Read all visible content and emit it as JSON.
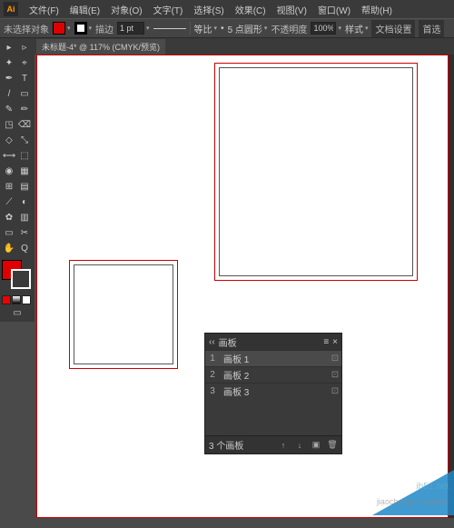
{
  "menu": {
    "items": [
      "文件(F)",
      "编辑(E)",
      "对象(O)",
      "文字(T)",
      "选择(S)",
      "效果(C)",
      "视图(V)",
      "窗口(W)",
      "帮助(H)"
    ]
  },
  "control": {
    "no_selection": "未选择对象",
    "fill_color": "#e00000",
    "stroke_color": "#000000",
    "stroke_label": "描边",
    "stroke_weight": "1 pt",
    "scale_label": "等比",
    "corner_label": "5 点圆形",
    "opacity_label": "不透明度",
    "opacity_value": "100%",
    "style_label": "样式",
    "doc_setup": "文档设置",
    "prefs": "首选"
  },
  "doc": {
    "tab": "未标题-4* @ 117% (CMYK/预览)"
  },
  "tools": {
    "row": [
      "▸",
      "▹",
      "✦",
      "⌖",
      "T",
      "/",
      "✎",
      "◳",
      "✂",
      "◐",
      "✿",
      "◇",
      "⟲",
      "▭",
      "◉",
      "⚲",
      "✋",
      "⬚",
      "Q",
      "⤢"
    ]
  },
  "swatches": {
    "fill": "#e00000",
    "minis": [
      "#e00000",
      "#ffffff",
      "#000000"
    ]
  },
  "panel": {
    "title": "画板",
    "rows": [
      {
        "n": "1",
        "name": "画板 1",
        "sel": true
      },
      {
        "n": "2",
        "name": "画板 2",
        "sel": false
      },
      {
        "n": "3",
        "name": "画板 3",
        "sel": false
      }
    ],
    "footer_count": "3 个画板",
    "menu_icon": "≡",
    "close_icon": "×",
    "min_icon": "‹‹"
  },
  "watermark": {
    "l1": "ib51.net",
    "l2": "jiaocheng.chazidian"
  }
}
